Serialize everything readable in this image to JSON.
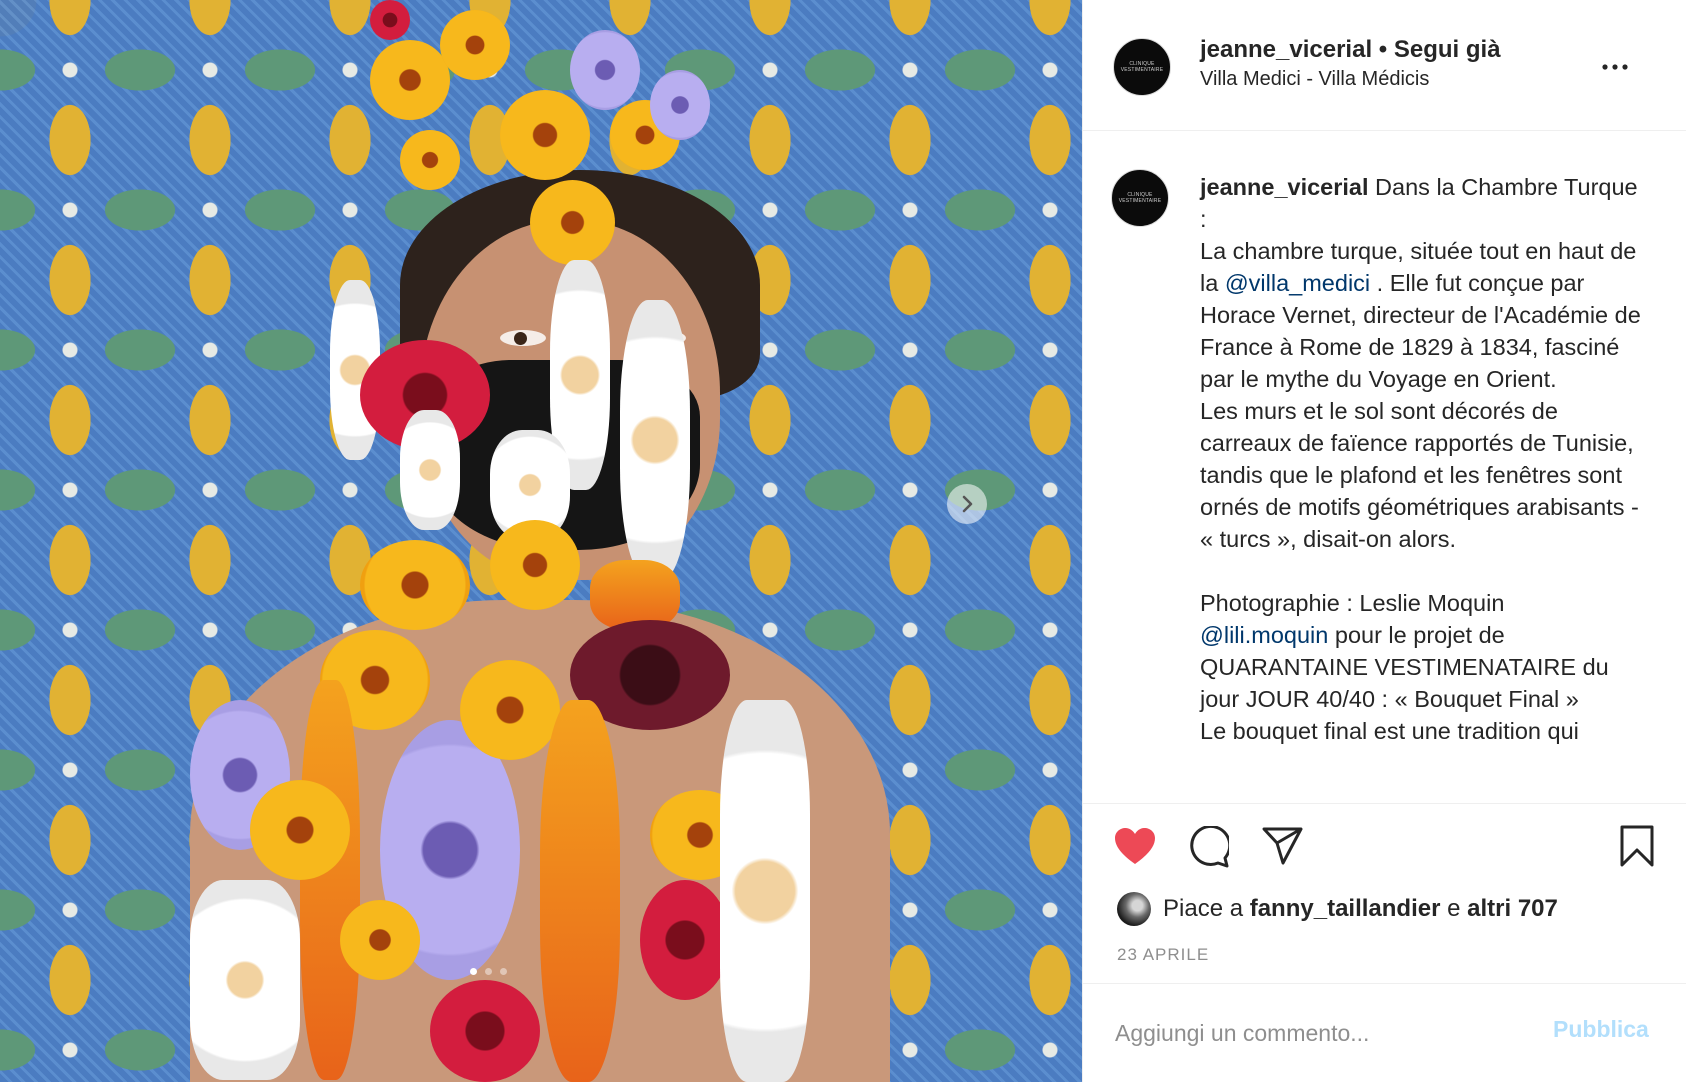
{
  "post": {
    "username": "jeanne_vicerial",
    "separator": " • ",
    "follow_status": "Segui già",
    "location": "Villa Medici - Villa Médicis",
    "avatar_text": "CLINIQUE VESTIMENTAIRE"
  },
  "caption": {
    "username": "jeanne_vicerial",
    "intro": " Dans la Chambre Turque :",
    "line1_pre": "La chambre turque, située tout en haut de la ",
    "mention1": "@villa_medici",
    "line1_post": " . Elle fut conçue par Horace Vernet, directeur de l'Académie de France à Rome de 1829 à 1834, fasciné par le mythe du Voyage en Orient.",
    "paragraph2": "Les murs et le sol sont décorés de carreaux de faïence rapportés de Tunisie, tandis que le plafond et les fenêtres sont ornés de motifs géométriques arabisants - « turcs », disait-on alors.",
    "photo_pre": "Photographie : Leslie Moquin",
    "mention2": "@lili.moquin",
    "photo_post": " pour le projet de QUARANTAINE VESTIMENATAIRE du jour JOUR 40/40 : « Bouquet Final »",
    "cutoff": "Le bouquet final est une tradition qui"
  },
  "likes": {
    "prefix": "Piace a ",
    "first_user": "fanny_taillandier",
    "conjunction": " e ",
    "others": "altri 707"
  },
  "date": "23 APRILE",
  "comment": {
    "placeholder": "Aggiungi un commento...",
    "publish_label": "Pubblica"
  },
  "carousel": {
    "total_slides": 3,
    "active_slide": 1
  },
  "colors": {
    "like_red": "#ed4956",
    "mention_blue": "#00376b",
    "publish_disabled": "#b2dffc",
    "meta_gray": "#8e8e8e"
  },
  "icons": {
    "like": "heart-filled-icon",
    "comment": "speech-bubble-icon",
    "share": "paper-plane-icon",
    "save": "bookmark-icon",
    "more": "ellipsis-icon",
    "next": "chevron-right-icon"
  }
}
